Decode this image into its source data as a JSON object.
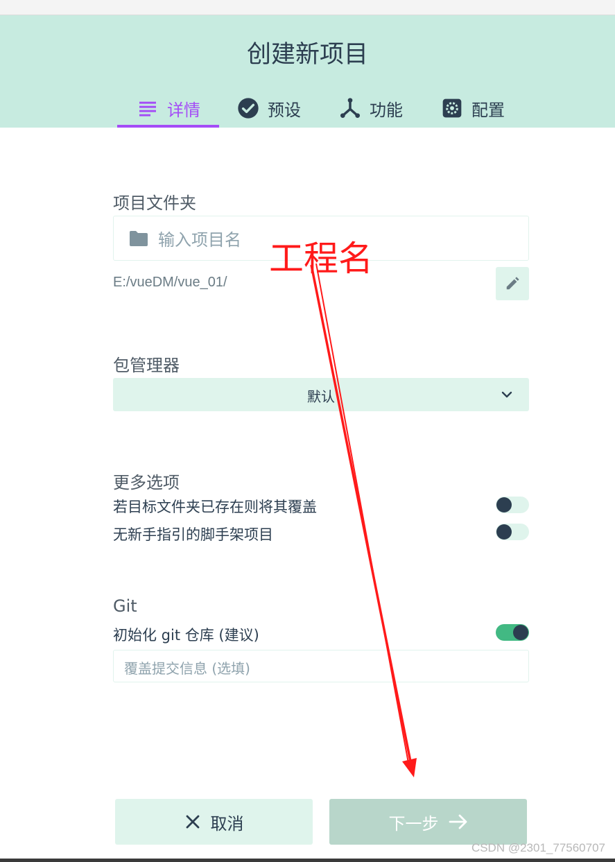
{
  "header": {
    "title": "创建新项目",
    "tabs": [
      {
        "label": "详情",
        "icon": "list-icon",
        "active": true
      },
      {
        "label": "预设",
        "icon": "check-circle-icon",
        "active": false
      },
      {
        "label": "功能",
        "icon": "fork-icon",
        "active": false
      },
      {
        "label": "配置",
        "icon": "gear-icon",
        "active": false
      }
    ]
  },
  "folder": {
    "label": "项目文件夹",
    "placeholder": "输入项目名",
    "path": "E:/vueDM/vue_01/"
  },
  "package_manager": {
    "label": "包管理器",
    "value": "默认"
  },
  "more_options": {
    "label": "更多选项",
    "items": [
      {
        "label": "若目标文件夹已存在则将其覆盖",
        "enabled": false
      },
      {
        "label": "无新手指引的脚手架项目",
        "enabled": false
      }
    ]
  },
  "git": {
    "label": "Git",
    "init_label": "初始化 git 仓库 (建议)",
    "init_enabled": true,
    "commit_placeholder": "覆盖提交信息 (选填)"
  },
  "footer": {
    "cancel_label": "取消",
    "next_label": "下一步"
  },
  "annotation": {
    "text": "工程名",
    "color": "#ff1a1a"
  },
  "watermark": "CSDN @2301_77560707",
  "colors": {
    "header_bg": "#c7ebe0",
    "accent": "#a44cf6",
    "primary": "#42b983",
    "dark": "#2c3e50"
  }
}
